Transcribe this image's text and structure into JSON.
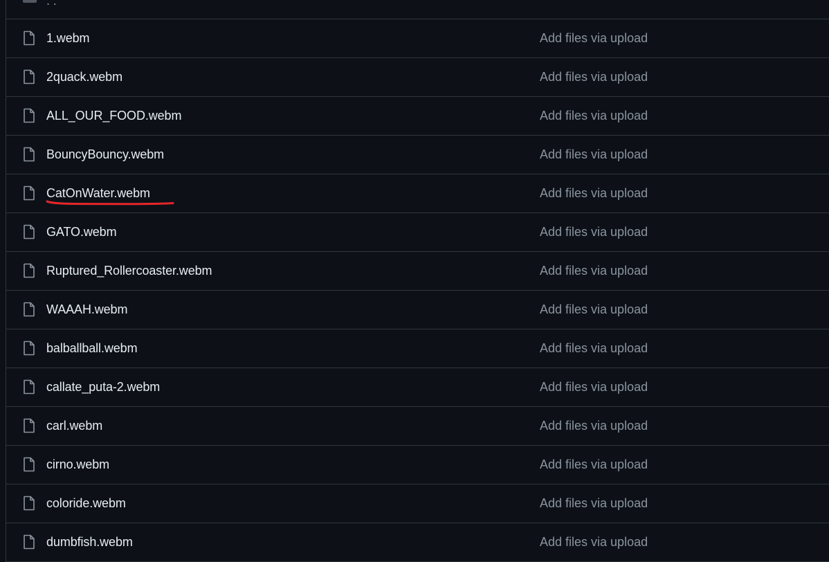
{
  "file_list": {
    "parent_row": {
      "label": ". .",
      "icon": "folder-icon"
    },
    "commit_message": "Add files via upload",
    "files": [
      "1.webm",
      "2quack.webm",
      "ALL_OUR_FOOD.webm",
      "BouncyBouncy.webm",
      "CatOnWater.webm",
      "GATO.webm",
      "Ruptured_Rollercoaster.webm",
      "WAAAH.webm",
      "balballball.webm",
      "callate_puta-2.webm",
      "carl.webm",
      "cirno.webm",
      "coloride.webm",
      "dumbfish.webm"
    ],
    "highlighted_file": "CatOnWater.webm",
    "highlight_color": "#e5262b",
    "file_icon": "file-icon"
  }
}
